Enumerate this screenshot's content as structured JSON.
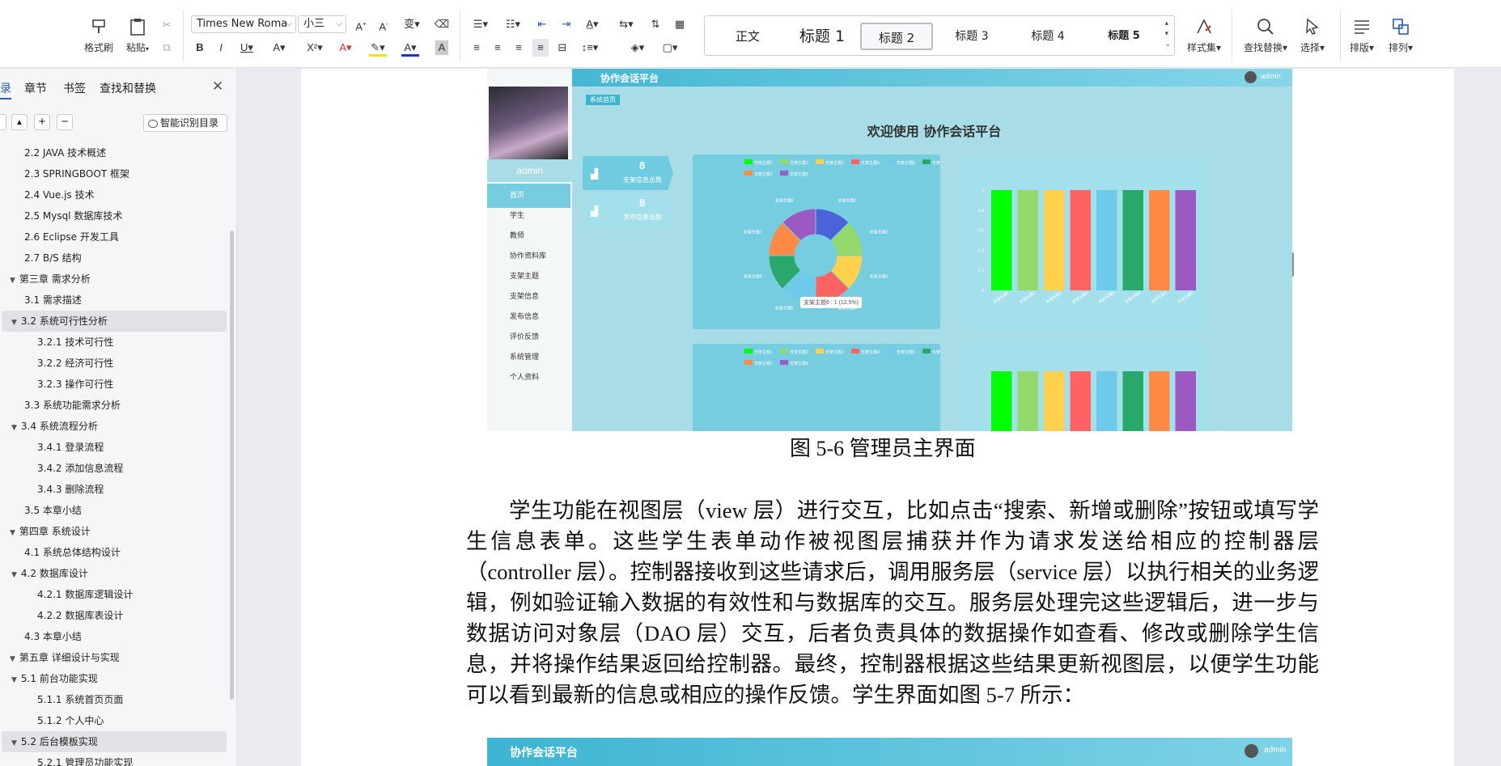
{
  "ribbon": {
    "format_painter": "格式刷",
    "paste": "粘贴",
    "font_name": "Times New Roma",
    "font_size": "小三",
    "styles": [
      "正文",
      "标题  1",
      "标题  2",
      "标题  3",
      "标题  4",
      "标题  5"
    ],
    "style_set": "样式集",
    "find_replace": "查找替换",
    "select": "选择",
    "layout": "排版",
    "arrange": "排列"
  },
  "nav": {
    "tabs": [
      "录",
      "章节",
      "书签",
      "查找和替换"
    ],
    "smart_toc": "智能识别目录",
    "items": [
      "2.2 JAVA 技术概述",
      "2.3 SPRINGBOOT  框架",
      "2.4 Vue.js 技术",
      "2.5 Mysql 数据库技术",
      "2.6 Eclipse 开发工具",
      "2.7 B/S 结构",
      "第三章  需求分析",
      "3.1  需求描述",
      "3.2  系统可行性分析",
      "3.2.1 技术可行性",
      "3.2.2  经济可行性",
      "3.2.3  操作可行性",
      "3.3  系统功能需求分析",
      "3.4  系统流程分析",
      "3.4.1  登录流程",
      "3.4.2  添加信息流程",
      "3.4.3  删除流程",
      "3.5  本章小结",
      "第四章  系统设计",
      "4.1  系统总体结构设计",
      "4.2  数据库设计",
      "4.2.1  数据库逻辑设计",
      "4.2.2  数据库表设计",
      "4.3  本章小结",
      "第五章  详细设计与实现",
      "5.1  前台功能实现",
      "5.1.1  系统首页页面",
      "5.1.2 个人中心",
      "5.2 后台模板实现",
      "5.2.1 管理员功能实现"
    ]
  },
  "doc": {
    "figure_caption": "图 5-6 管理员主界面",
    "paragraph": "学生功能在视图层（view 层）进行交互，比如点击“搜索、新增或删除”按钮或填写学生信息表单。这些学生表单动作被视图层捕获并作为请求发送给相应的控制器层（controller 层）。控制器接收到这些请求后，调用服务层（service 层）以执行相关的业务逻辑，例如验证输入数据的有效性和与数据库的交互。服务层处理完这些逻辑后，进一步与数据访问对象层（DAO 层）交互，后者负责具体的数据操作如查看、修改或删除学生信息，并将操作结果返回给控制器。最终，控制器根据这些结果更新视图层，以便学生功能可以看到最新的信息或相应的操作反馈。学生界面如图 5-7 所示："
  },
  "app": {
    "title": "协作会话平台",
    "user": "admin",
    "breadcrumb": "系统首页",
    "welcome": "欢迎使用 协作会话平台",
    "side_menu": [
      "首页",
      "学生",
      "教师",
      "协作资料库",
      "支架主题",
      "支架信息",
      "发布信息",
      "评价反馈",
      "系统管理",
      "个人资料"
    ],
    "stat1_value": "8",
    "stat1_label": "支架信息总数",
    "stat2_value": "8",
    "stat2_label": "发布信息总数",
    "tooltip": "支架主题6 : 1 (12.5%)"
  },
  "chart_data": [
    {
      "type": "pie",
      "title": "",
      "categories": [
        "支架主题1",
        "支架主题2",
        "支架主题3",
        "支架主题4",
        "支架主题5",
        "支架主题6",
        "支架主题7",
        "支架主题8"
      ],
      "values": [
        1,
        1,
        1,
        1,
        1,
        1,
        1,
        1
      ]
    },
    {
      "type": "bar",
      "categories": [
        "支架主题1",
        "支架主题2",
        "支架主题3",
        "支架主题4",
        "支架主题5",
        "支架主题6",
        "支架主题7",
        "支架主题8"
      ],
      "values": [
        1,
        1,
        1,
        1,
        1,
        1,
        1,
        1
      ],
      "ylim": [
        0,
        1
      ]
    }
  ],
  "colors": [
    "#00ff00",
    "#93d96c",
    "#ffd14d",
    "#ff6262",
    "#6dcaeb",
    "#2aa86b",
    "#ff8a45",
    "#9c59c2"
  ]
}
